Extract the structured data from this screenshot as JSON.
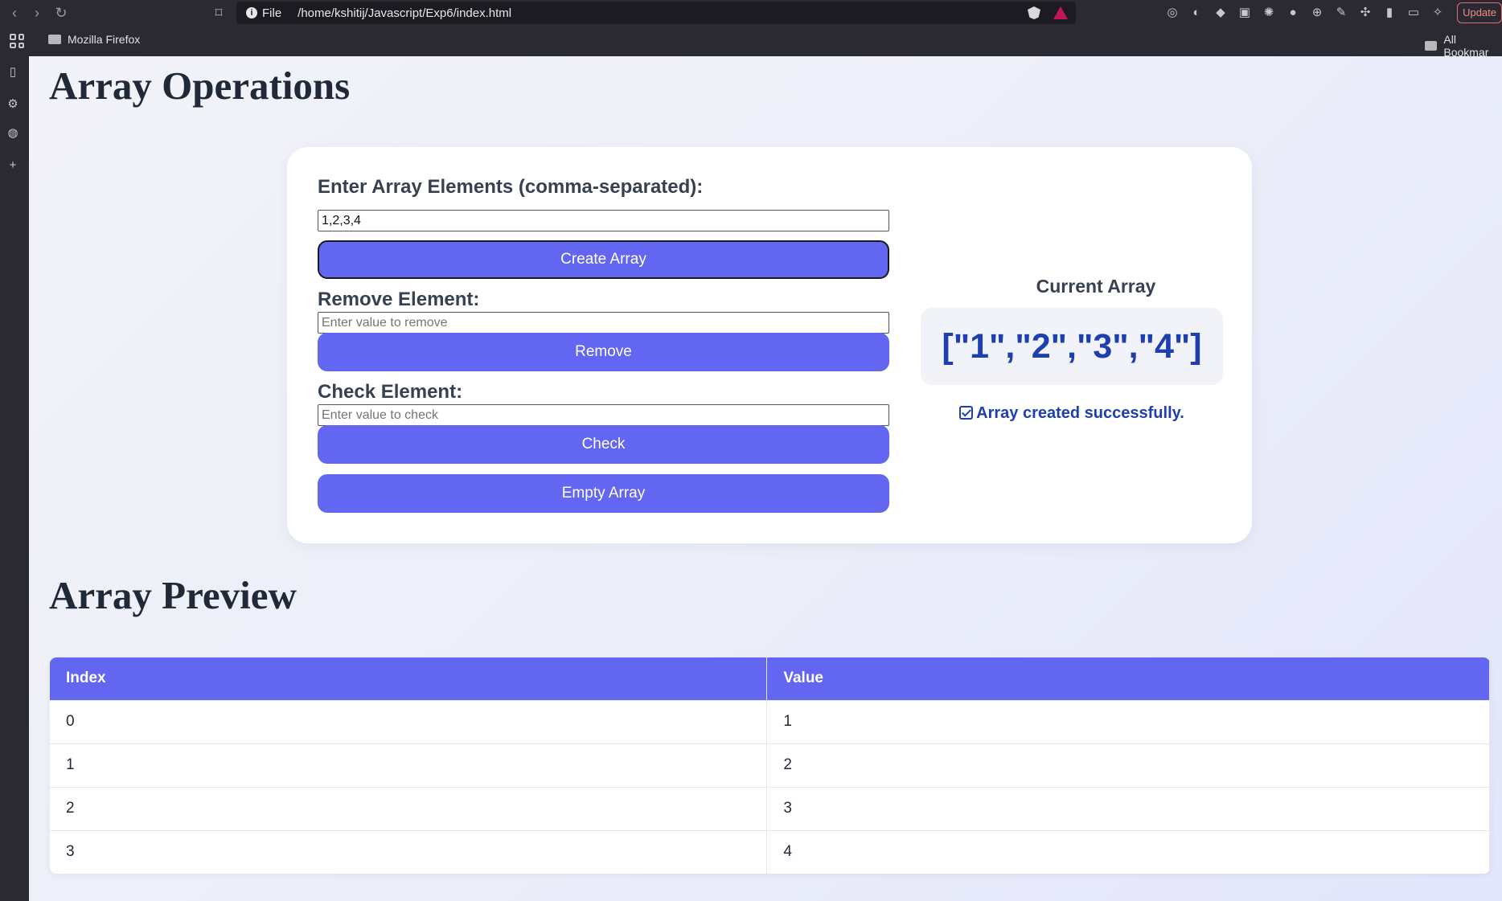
{
  "browser": {
    "file_label": "File",
    "url": "/home/kshitij/Javascript/Exp6/index.html",
    "update_label": "Update",
    "bookmarks": {
      "item1": "Mozilla Firefox",
      "all": "All Bookmar"
    }
  },
  "page": {
    "title": "Array Operations",
    "preview_title": "Array Preview"
  },
  "form": {
    "create_label": "Enter Array Elements (comma-separated):",
    "create_value": "1,2,3,4",
    "create_button": "Create Array",
    "remove_label": "Remove Element:",
    "remove_placeholder": "Enter value to remove",
    "remove_button": "Remove",
    "check_label": "Check Element:",
    "check_placeholder": "Enter value to check",
    "check_button": "Check",
    "empty_button": "Empty Array"
  },
  "current": {
    "title": "Current Array",
    "value": "[\"1\",\"2\",\"3\",\"4\"]",
    "message": "Array created successfully."
  },
  "table": {
    "headers": [
      "Index",
      "Value"
    ],
    "rows": [
      [
        "0",
        "1"
      ],
      [
        "1",
        "2"
      ],
      [
        "2",
        "3"
      ],
      [
        "3",
        "4"
      ]
    ]
  },
  "colors": {
    "accent": "#6366f1",
    "value_text": "#1e40af"
  }
}
